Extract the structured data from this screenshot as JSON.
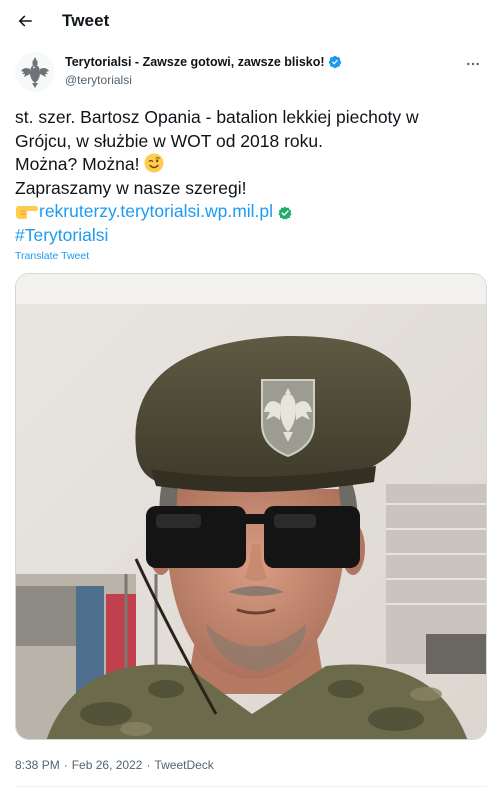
{
  "header": {
    "title": "Tweet",
    "back_icon": "arrow-left-icon"
  },
  "author": {
    "display_name": "Terytorialsi - Zawsze gotowi, zawsze blisko!",
    "handle": "@terytorialsi",
    "verified": true,
    "avatar_icon": "polish-eagle-emblem-icon",
    "more_icon": "more-dots-icon"
  },
  "tweet": {
    "line1": "st. szer. Bartosz Opania - batalion lekkiej piechoty w",
    "line2": "Grójcu, w służbie w WOT od 2018 roku.",
    "line3_text": "Można? Można!",
    "line3_emoji": "winking-face-emoji",
    "line4": "Zapraszamy w nasze szeregi!",
    "link_emoji": "backhand-index-pointing-right-emoji",
    "link": "rekruterzy.terytorialsi.wp.mil.pl",
    "link_badge": "check-badge-icon",
    "hashtag": "#Terytorialsi"
  },
  "translate_label": "Translate Tweet",
  "media": {
    "type": "photo",
    "subject": "selfie-soldier-beret-sunglasses"
  },
  "meta": {
    "time": "8:38 PM",
    "date": "Feb 26, 2022",
    "source": "TweetDeck",
    "separator": "·"
  },
  "colors": {
    "link": "#1d9bf0",
    "verified": "#1d9bf0",
    "text": "#0f1419",
    "secondary": "#536471",
    "border": "#cfd9de"
  }
}
